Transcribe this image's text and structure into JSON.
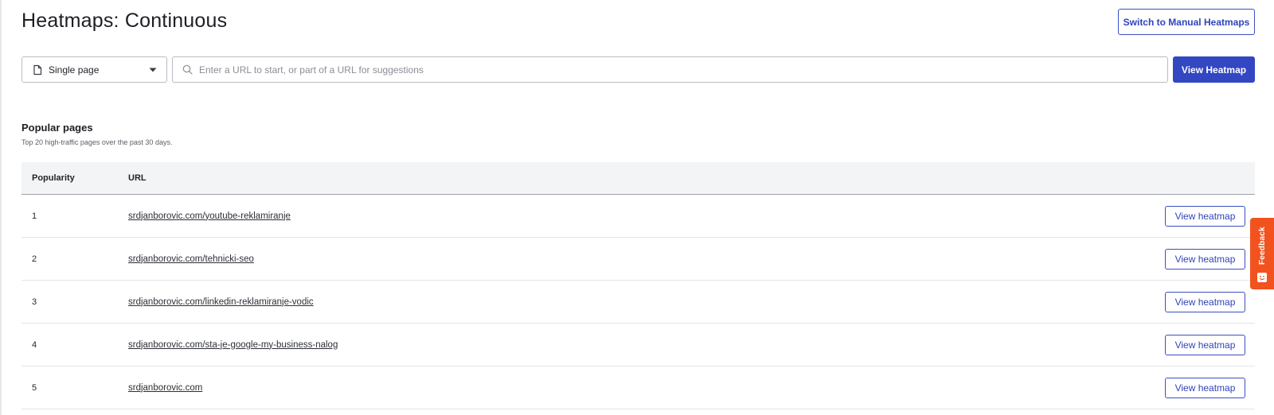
{
  "header": {
    "title": "Heatmaps: Continuous",
    "switch_button": "Switch to Manual Heatmaps"
  },
  "toolbar": {
    "mode_select": {
      "selected": "Single page",
      "icon": "document-icon"
    },
    "url_input": {
      "value": "",
      "placeholder": "Enter a URL to start, or part of a URL for suggestions"
    },
    "view_button": "View Heatmap"
  },
  "popular": {
    "title": "Popular pages",
    "subtitle": "Top 20 high-traffic pages over the past 30 days.",
    "columns": {
      "popularity": "Popularity",
      "url": "URL"
    },
    "rows": [
      {
        "rank": "1",
        "url": "srdjanborovic.com/youtube-reklamiranje",
        "action": "View heatmap"
      },
      {
        "rank": "2",
        "url": "srdjanborovic.com/tehnicki-seo",
        "action": "View heatmap"
      },
      {
        "rank": "3",
        "url": "srdjanborovic.com/linkedin-reklamiranje-vodic",
        "action": "View heatmap"
      },
      {
        "rank": "4",
        "url": "srdjanborovic.com/sta-je-google-my-business-nalog",
        "action": "View heatmap"
      },
      {
        "rank": "5",
        "url": "srdjanborovic.com",
        "action": "View heatmap"
      }
    ]
  },
  "feedback": {
    "label": "Feedback",
    "icon": "smiley-icon"
  },
  "colors": {
    "primary": "#3347c3",
    "feedback": "#f2521e",
    "table_header_bg": "#f3f4f6"
  }
}
